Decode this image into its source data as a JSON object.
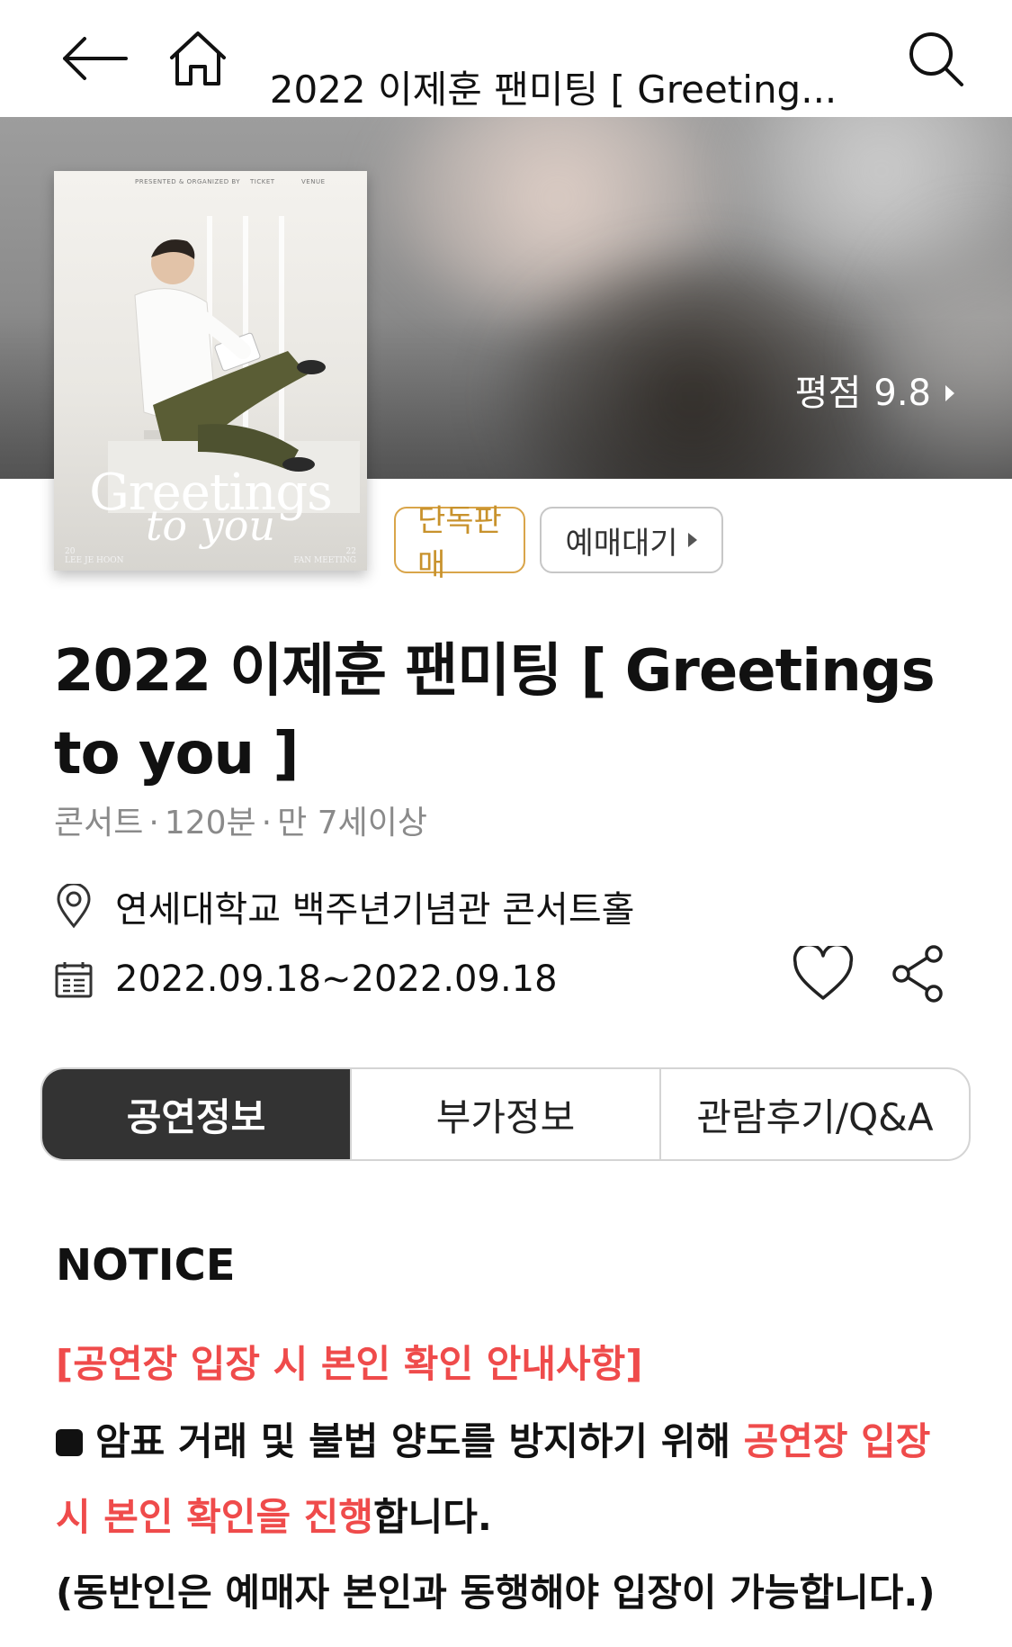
{
  "topbar": {
    "title": "2022 이제훈 팬미팅 [ Greeting..."
  },
  "hero": {
    "rating_label": "평점",
    "rating_value": "9.8"
  },
  "poster": {
    "header_items": [
      "PRESENTED & ORGANIZED BY",
      "TICKET",
      "VENUE"
    ],
    "title_main": "Greetings",
    "title_sub": "to you",
    "footer_left_year": "20",
    "footer_left_name": "LEE JE HOON",
    "footer_right_year": "22",
    "footer_right_text": "FAN MEETING"
  },
  "badges": {
    "exclusive": "단독판매",
    "wait": "예매대기"
  },
  "show": {
    "title": "2022 이제훈 팬미팅 [ Greetings to you ]",
    "genre": "콘서트",
    "duration": "120분",
    "age": "만 7세이상",
    "venue": "연세대학교 백주년기념관 콘서트홀",
    "date": "2022.09.18~2022.09.18"
  },
  "tabs": [
    {
      "label": "공연정보",
      "active": true
    },
    {
      "label": "부가정보",
      "active": false
    },
    {
      "label": "관람후기/Q&A",
      "active": false
    }
  ],
  "notice": {
    "heading": "NOTICE",
    "subheading": "[공연장 입장 시 본인 확인 안내사항]",
    "body_part1": "암표 거래 및 불법 양도를 방지하기 위해 ",
    "body_red": "공연장 입장 시 본인 확인을 진행",
    "body_part2": "합니다.",
    "body_line2": "(동반인은 예매자 본인과 동행해야 입장이 가능합니다.)"
  },
  "colors": {
    "accent_red": "#ef4b4b",
    "badge_gold": "#d9a54a",
    "tab_active_bg": "#333333"
  },
  "icons": {
    "back": "arrow-left-icon",
    "home": "home-icon",
    "search": "search-icon",
    "venue": "location-pin-icon",
    "date": "calendar-icon",
    "like": "heart-icon",
    "share": "share-icon"
  }
}
